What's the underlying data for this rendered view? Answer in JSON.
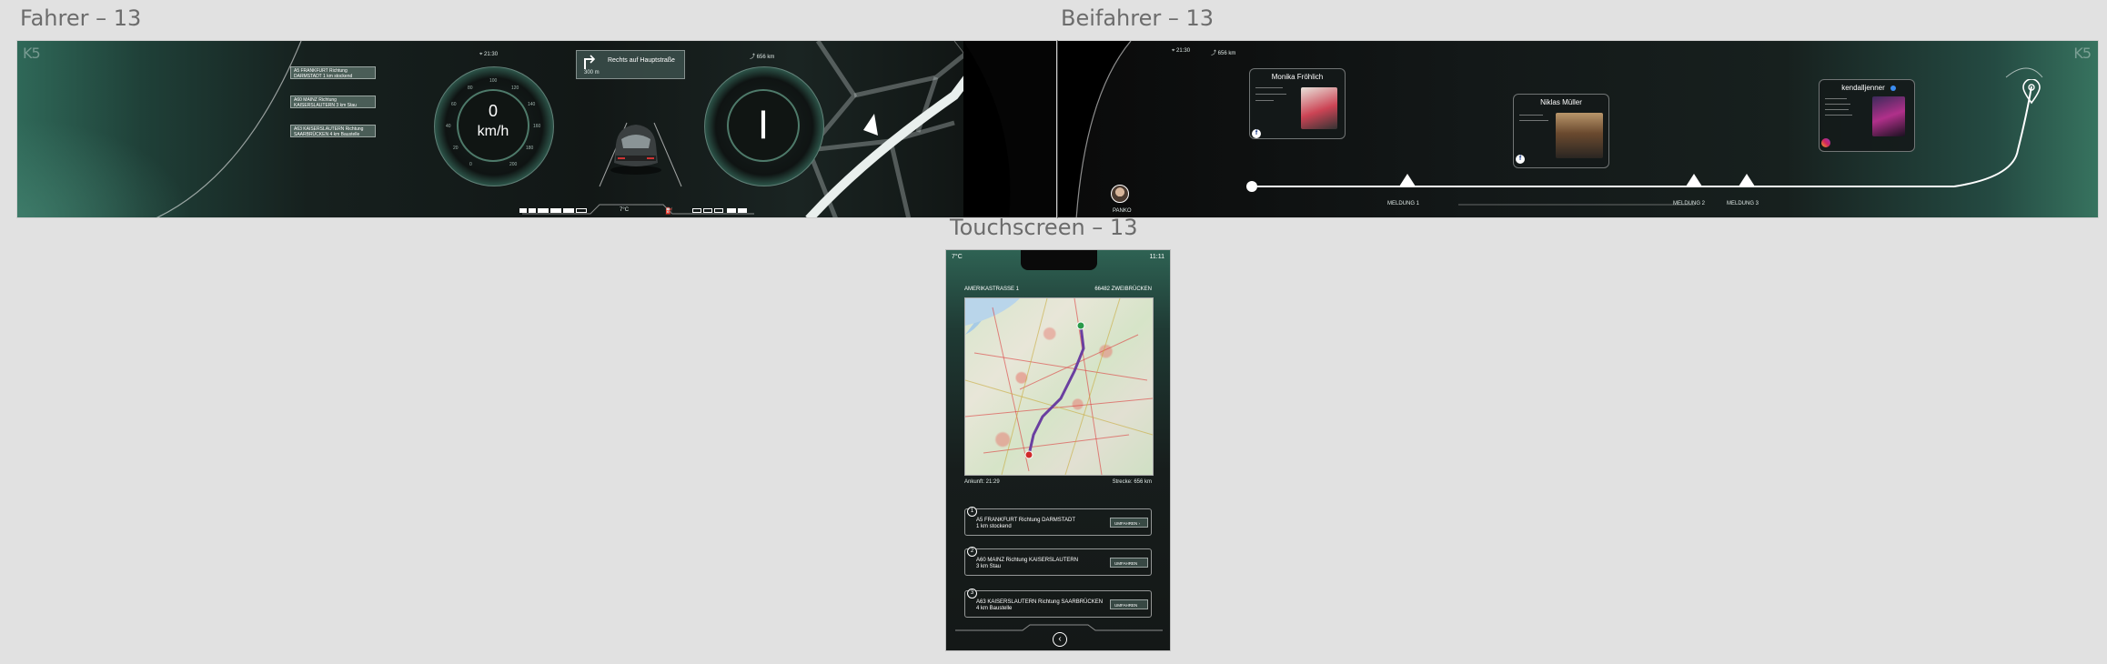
{
  "frames": {
    "driver_label": "Fahrer – 13",
    "passenger_label": "Beifahrer – 13",
    "touch_label": "Touchscreen – 13"
  },
  "brand": {
    "logo": "K5"
  },
  "driver": {
    "nav_items": [
      "A5 FRANKFURT Richtung DARMSTADT 1 km stockend",
      "A60 MAINZ Richtung KAISERSLAUTERN 3 km Stau",
      "A63 KAISERSLAUTERN Richtung SAARBRÜCKEN 4 km Baustelle"
    ],
    "time": "21:30",
    "distance": "656 km",
    "speed_value": "0",
    "speed_unit": "km/h",
    "speed_ticks": [
      "0",
      "20",
      "40",
      "60",
      "80",
      "100",
      "120",
      "140",
      "160",
      "180",
      "200"
    ],
    "gear": "|",
    "direction": {
      "text": "Rechts auf Hauptstraße",
      "distance": "300 m"
    },
    "temperature": "7°C"
  },
  "passenger": {
    "time": "21:30",
    "distance": "656 km",
    "profile_label": "PANKO",
    "cards": [
      {
        "name": "Monika Fröhlich"
      },
      {
        "name": "Niklas Müller"
      },
      {
        "name": "kendalljenner"
      }
    ],
    "markers": [
      "MELDUNG 1",
      "MELDUNG 2",
      "MELDUNG 3"
    ]
  },
  "touch": {
    "temperature": "7°C",
    "clock": "11:11",
    "street": "AMERIKASTRASSE 1",
    "city": "66482 ZWEIBRÜCKEN",
    "arrival": "Ankunft: 21:29",
    "route_distance": "Strecke: 656 km",
    "entries": [
      {
        "num": "1",
        "line1": "A5 FRANKFURT Richtung DARMSTADT",
        "line2": "1 km stockend",
        "button": "UMFAHREN"
      },
      {
        "num": "2",
        "line1": "A60 MAINZ Richtung KAISERSLAUTERN",
        "line2": "3 km Stau",
        "button": "UMFAHREN"
      },
      {
        "num": "3",
        "line1": "A63 KAISERSLAUTERN Richtung SAARBRÜCKEN",
        "line2": "4 km Baustelle",
        "button": "UMFAHREN"
      }
    ]
  },
  "colors": {
    "accent": "#2f6858",
    "dark": "#141817",
    "canvas": "#e1e1e1"
  }
}
